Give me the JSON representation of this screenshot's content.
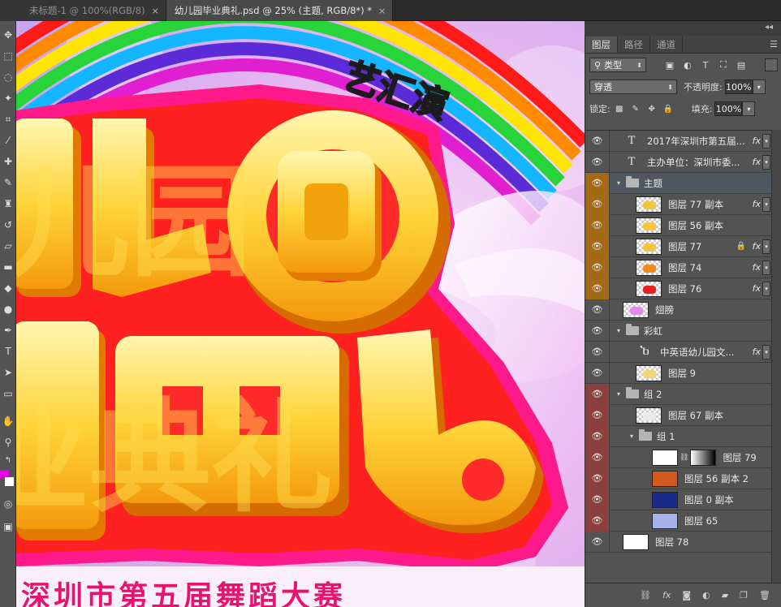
{
  "tabs": [
    {
      "label": "未标题-1 @ 100%(RGB/8)",
      "close": "×"
    },
    {
      "label": "幼儿园毕业典礼.psd @ 25% (主题, RGB/8*) *",
      "close": "×"
    }
  ],
  "canvas": {
    "line_top": "艺汇演",
    "line1": "儿园",
    "line2": "业典礼",
    "bottom_title": "深圳市第五届舞蹈大赛"
  },
  "colors": {
    "fg_swatch": "#e600e6",
    "bg_swatch": "#ffffff"
  },
  "panel": {
    "tabs": [
      "图层",
      "路径",
      "通道"
    ],
    "menu_icon": "panel-menu-icon",
    "filter": {
      "label": "类型",
      "icon": "search-icon"
    },
    "filter_icons": [
      "image-filter-icon",
      "adjustment-filter-icon",
      "type-filter-icon",
      "shape-filter-icon",
      "smartobject-filter-icon"
    ],
    "blend_mode": "穿透",
    "opacity_label": "不透明度:",
    "opacity_value": "100%",
    "lock_label": "锁定:",
    "fill_label": "填充:",
    "fill_value": "100%",
    "layers": [
      {
        "name": "2017年深圳市第五届...",
        "kind": "text",
        "color": "none",
        "fx": "fx",
        "indent": 0
      },
      {
        "name": "主办单位：深圳市委...",
        "kind": "text",
        "color": "none",
        "fx": "fx",
        "indent": 0
      },
      {
        "name": "主题",
        "kind": "group",
        "color": "orange",
        "fx": "",
        "indent": 0,
        "selected": true
      },
      {
        "name": "图层 77 副本",
        "kind": "pixel",
        "color": "orange",
        "fx": "fx",
        "indent": 1,
        "thumb": "#f5c542"
      },
      {
        "name": "图层 56 副本",
        "kind": "pixel",
        "color": "orange",
        "fx": "",
        "indent": 1,
        "thumb": "#f5c542"
      },
      {
        "name": "图层 77",
        "kind": "pixel",
        "color": "orange",
        "fx": "fx",
        "indent": 1,
        "thumb": "#f5c542",
        "locked": true
      },
      {
        "name": "图层 74",
        "kind": "pixel",
        "color": "orange",
        "fx": "fx",
        "indent": 1,
        "thumb": "#f28a1e"
      },
      {
        "name": "图层 76",
        "kind": "pixel",
        "color": "orange",
        "fx": "fx",
        "indent": 1,
        "thumb": "#e52020"
      },
      {
        "name": "翅膀",
        "kind": "pixel",
        "color": "none",
        "fx": "",
        "indent": 0,
        "thumb": "#e58ae8"
      },
      {
        "name": "彩虹",
        "kind": "group",
        "color": "none",
        "fx": "",
        "indent": 0
      },
      {
        "name": "中英语幼儿园文...",
        "kind": "warp-text",
        "color": "none",
        "fx": "fx",
        "indent": 1
      },
      {
        "name": "图层 9",
        "kind": "pixel",
        "color": "none",
        "fx": "",
        "indent": 1,
        "thumb": "#f2d77a"
      },
      {
        "name": "组 2",
        "kind": "group",
        "color": "red",
        "fx": "",
        "indent": 0
      },
      {
        "name": "图层 67 副本",
        "kind": "pixel",
        "color": "red",
        "fx": "",
        "indent": 1,
        "thumb": "#eaeaea"
      },
      {
        "name": "组 1",
        "kind": "group",
        "color": "red",
        "fx": "",
        "indent": 1
      },
      {
        "name": "图层 79",
        "kind": "masked",
        "color": "red",
        "fx": "",
        "indent": 2
      },
      {
        "name": "图层 56 副本 2",
        "kind": "photo",
        "color": "red",
        "fx": "",
        "indent": 2,
        "thumb": "#d35a1e"
      },
      {
        "name": "图层 0 副本",
        "kind": "photo",
        "color": "red",
        "fx": "",
        "indent": 2,
        "thumb": "#1a2a8a"
      },
      {
        "name": "图层 65",
        "kind": "photo",
        "color": "red",
        "fx": "",
        "indent": 2,
        "thumb": "#a6b3e8"
      },
      {
        "name": "图层 78",
        "kind": "white",
        "color": "none",
        "fx": "",
        "indent": 0
      }
    ],
    "bottom_icons": [
      "link-icon",
      "fx-icon",
      "mask-icon",
      "adjustment-icon",
      "group-icon",
      "new-layer-icon",
      "trash-icon"
    ]
  }
}
